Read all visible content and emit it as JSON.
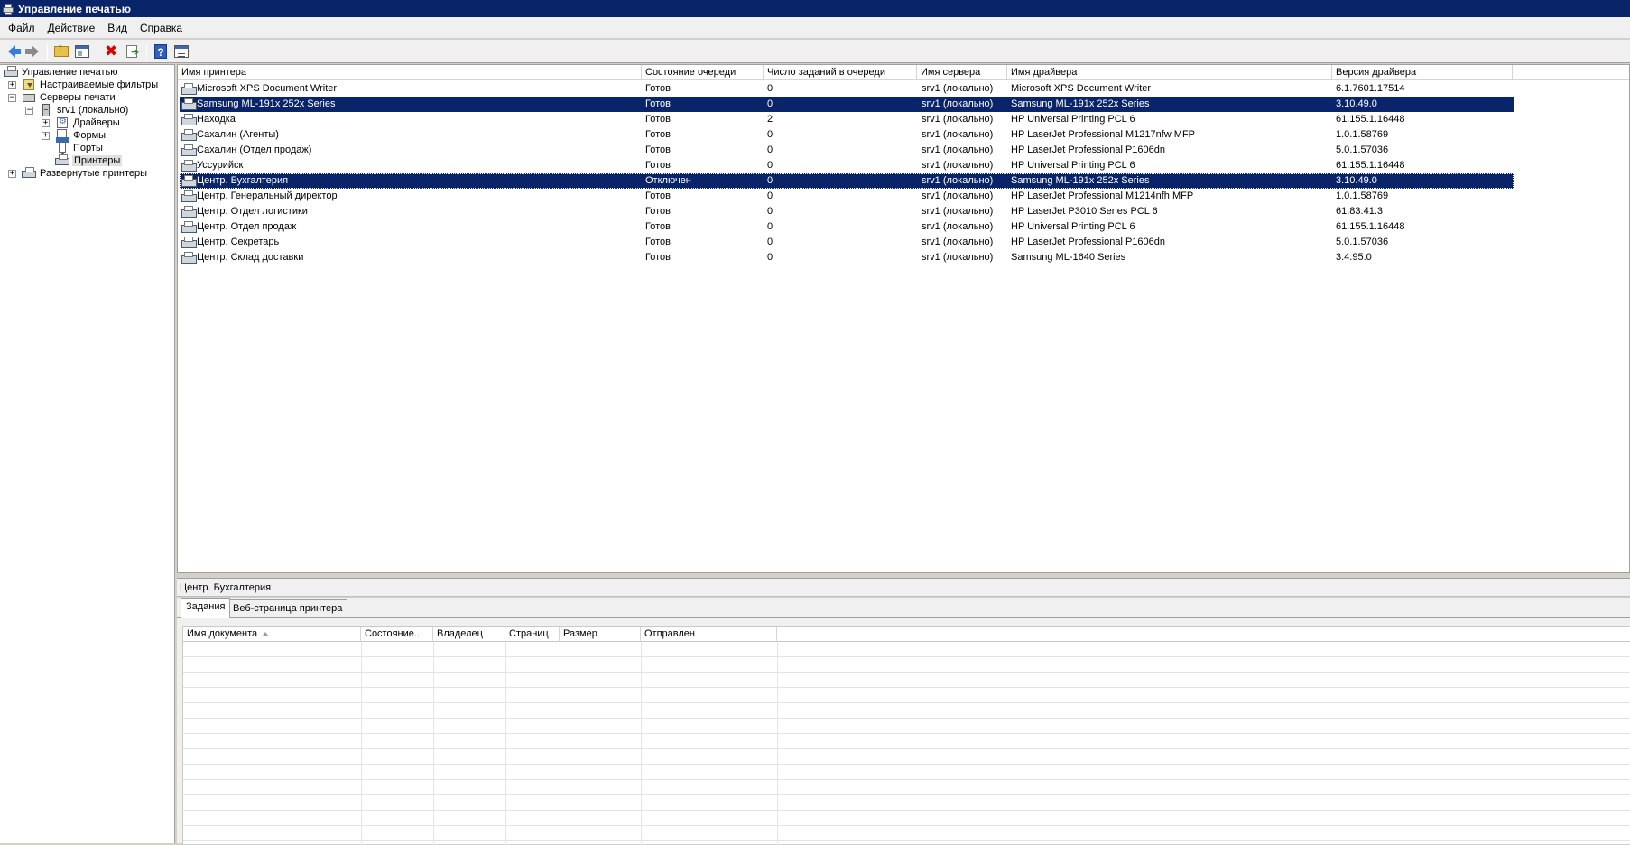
{
  "window": {
    "title": "Управление печатью"
  },
  "menu": [
    "Файл",
    "Действие",
    "Вид",
    "Справка"
  ],
  "toolbar": {
    "icons": [
      "back-arrow-icon",
      "forward-arrow-icon",
      "up-folder-icon",
      "show-hide-tree-icon",
      "delete-icon",
      "export-list-icon",
      "help-icon",
      "properties-icon"
    ]
  },
  "tree": {
    "root": "Управление печатью",
    "custom_filters": "Настраиваемые фильтры",
    "print_servers": "Серверы печати",
    "server": "srv1 (локально)",
    "drivers": "Драйверы",
    "forms": "Формы",
    "ports": "Порты",
    "printers": "Принтеры",
    "deployed_printers": "Развернутые принтеры",
    "expanded_symbol": "−",
    "collapsed_symbol": "+"
  },
  "printers": {
    "columns": [
      "Имя принтера",
      "Состояние очереди",
      "Число заданий в очереди",
      "Имя сервера",
      "Имя драйвера",
      "Версия драйвера"
    ],
    "rows": [
      {
        "name": "Microsoft XPS Document Writer",
        "status": "Готов",
        "jobs": "0",
        "server": "srv1 (локально)",
        "driver": "Microsoft XPS Document Writer",
        "version": "6.1.7601.17514"
      },
      {
        "name": "Samsung ML-191x 252x Series",
        "status": "Готов",
        "jobs": "0",
        "server": "srv1 (локально)",
        "driver": "Samsung ML-191x 252x Series",
        "version": "3.10.49.0"
      },
      {
        "name": "Находка",
        "status": "Готов",
        "jobs": "2",
        "server": "srv1 (локально)",
        "driver": "HP Universal Printing PCL 6",
        "version": "61.155.1.16448"
      },
      {
        "name": "Сахалин (Агенты)",
        "status": "Готов",
        "jobs": "0",
        "server": "srv1 (локально)",
        "driver": "HP LaserJet Professional M1217nfw MFP",
        "version": "1.0.1.58769"
      },
      {
        "name": "Сахалин (Отдел продаж)",
        "status": "Готов",
        "jobs": "0",
        "server": "srv1 (локально)",
        "driver": "HP LaserJet Professional P1606dn",
        "version": "5.0.1.57036"
      },
      {
        "name": "Уссурийск",
        "status": "Готов",
        "jobs": "0",
        "server": "srv1 (локально)",
        "driver": "HP Universal Printing PCL 6",
        "version": "61.155.1.16448"
      },
      {
        "name": "Центр. Бухгалтерия",
        "status": "Отключен",
        "jobs": "0",
        "server": "srv1 (локально)",
        "driver": "Samsung ML-191x 252x Series",
        "version": "3.10.49.0"
      },
      {
        "name": "Центр. Генеральный директор",
        "status": "Готов",
        "jobs": "0",
        "server": "srv1 (локально)",
        "driver": "HP LaserJet Professional M1214nfh MFP",
        "version": "1.0.1.58769"
      },
      {
        "name": "Центр. Отдел логистики",
        "status": "Готов",
        "jobs": "0",
        "server": "srv1 (локально)",
        "driver": "HP LaserJet P3010 Series PCL 6",
        "version": "61.83.41.3"
      },
      {
        "name": "Центр. Отдел продаж",
        "status": "Готов",
        "jobs": "0",
        "server": "srv1 (локально)",
        "driver": "HP Universal Printing PCL 6",
        "version": "61.155.1.16448"
      },
      {
        "name": "Центр. Секретарь",
        "status": "Готов",
        "jobs": "0",
        "server": "srv1 (локально)",
        "driver": "HP LaserJet Professional P1606dn",
        "version": "5.0.1.57036"
      },
      {
        "name": "Центр. Склад доставки",
        "status": "Готов",
        "jobs": "0",
        "server": "srv1 (локально)",
        "driver": "Samsung ML-1640 Series",
        "version": "3.4.95.0"
      }
    ]
  },
  "detail": {
    "title": "Центр. Бухгалтерия",
    "tabs": [
      "Задания",
      "Веб-страница принтера"
    ],
    "job_columns": [
      "Имя документа",
      "Состояние...",
      "Владелец",
      "Страниц",
      "Размер",
      "Отправлен"
    ]
  },
  "colors": {
    "titlebar": "#0a246a",
    "selection": "#0a246a"
  }
}
